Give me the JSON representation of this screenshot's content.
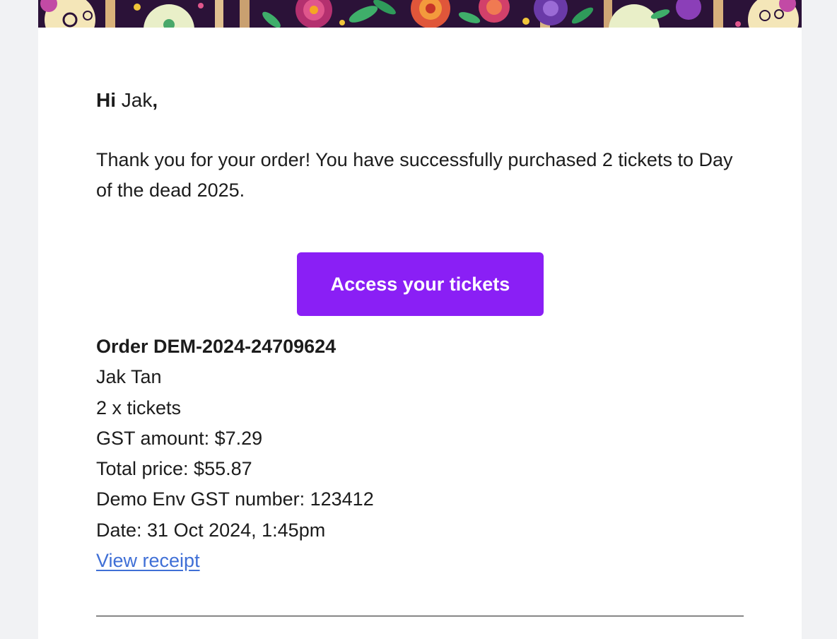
{
  "email": {
    "greeting": {
      "salutation": "Hi",
      "name": "Jak",
      "punctuation": ","
    },
    "message": "Thank you for your order! You have successfully purchased 2 tickets to Day of the dead 2025.",
    "cta": {
      "label": "Access your tickets"
    },
    "order": {
      "title": "Order DEM-2024-24709624",
      "customer": "Jak Tan",
      "quantity": "2 x tickets",
      "gst": "GST amount: $7.29",
      "total": "Total price: $55.87",
      "gst_number": "Demo Env GST number: 123412",
      "date": "Date: 31 Oct 2024, 1:45pm",
      "receipt_link": "View receipt"
    }
  },
  "colors": {
    "accent": "#8a1ff5",
    "link": "#3f6fd6",
    "text": "#1c1c1c",
    "page_bg": "#f1f2f4",
    "card_bg": "#ffffff"
  },
  "icons": {
    "banner": "floral-day-of-the-dead-banner"
  }
}
